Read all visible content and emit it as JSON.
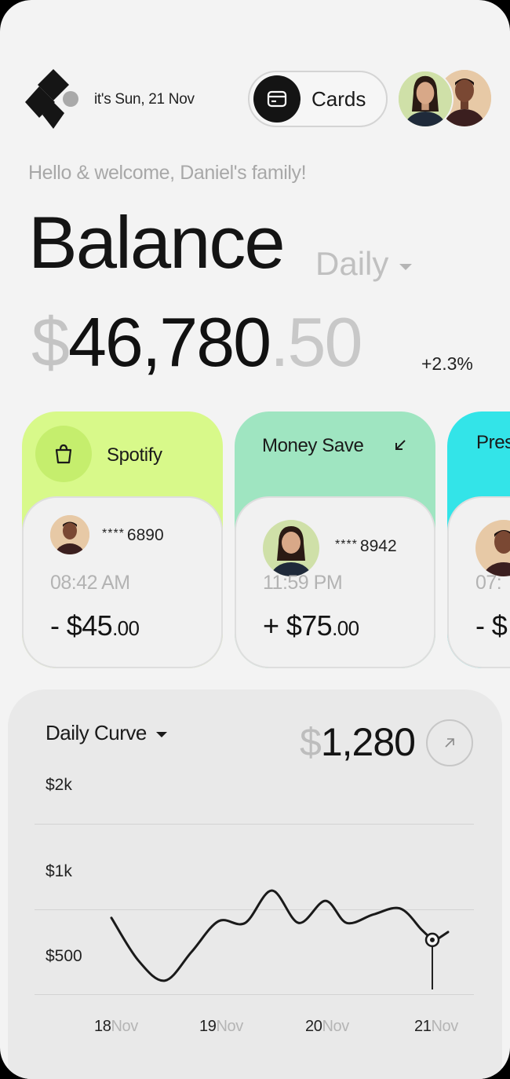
{
  "header": {
    "date_label": "it's Sun, 21 Nov",
    "cards_button_label": "Cards",
    "welcome": "Hello & welcome, Daniel's family!"
  },
  "balance": {
    "title": "Balance",
    "period": "Daily",
    "currency": "$",
    "amount_int": "46,780",
    "amount_dec": ".50",
    "change": "+2.3%"
  },
  "transactions": [
    {
      "title": "Spotify",
      "masked_card": "6890",
      "stars": "****",
      "time": "08:42 AM",
      "amount": "- $45",
      "cents": ".00",
      "color": "#d8f98a"
    },
    {
      "title": "Money Save",
      "masked_card": "8942",
      "stars": "****",
      "time": "11:59 PM",
      "amount": "+ $75",
      "cents": ".00",
      "color": "#9fe5c1"
    },
    {
      "title": "Pres",
      "time": "07:",
      "amount": "- $",
      "color": "#33e4e8"
    }
  ],
  "chart_data": {
    "type": "line",
    "title": "Daily Curve",
    "value_currency": "$",
    "value": "1,280",
    "y_ticks": [
      "$2k",
      "$1k",
      "$500"
    ],
    "x_ticks": [
      {
        "day": "18",
        "month": "Nov"
      },
      {
        "day": "19",
        "month": "Nov"
      },
      {
        "day": "20",
        "month": "Nov"
      },
      {
        "day": "21",
        "month": "Nov"
      }
    ],
    "series": [
      {
        "x": [
          18.0,
          18.25,
          18.5,
          18.75,
          19.0,
          19.25,
          19.5,
          19.75,
          20.0,
          20.2,
          20.45,
          20.7,
          20.9,
          21.0
        ],
        "y": [
          950,
          700,
          580,
          750,
          930,
          920,
          1220,
          920,
          1100,
          920,
          970,
          1010,
          880,
          820
        ]
      }
    ],
    "highlight": {
      "x": 21.0,
      "y": 820
    },
    "grid": true
  }
}
